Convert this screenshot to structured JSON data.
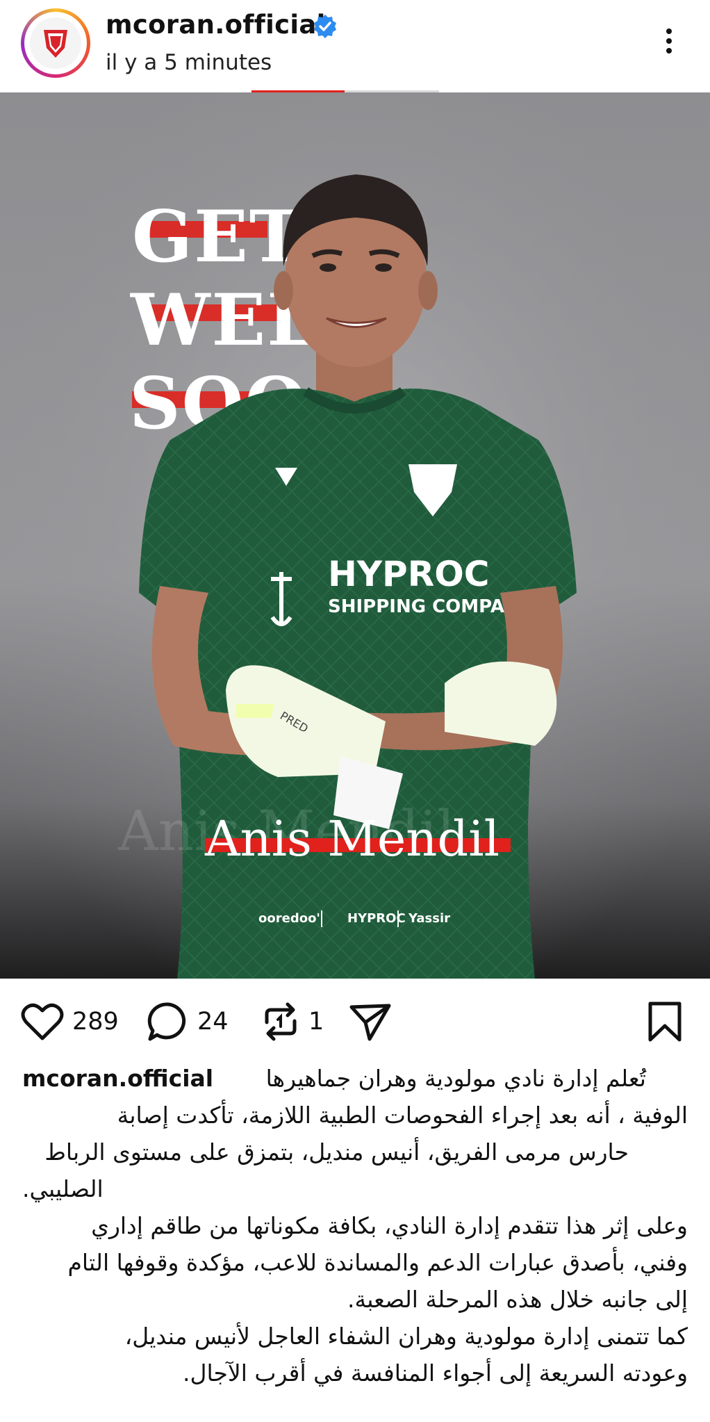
{
  "header": {
    "username": "mcoran.official",
    "timestamp": "il y a 5 minutes",
    "verified": true
  },
  "post": {
    "banner_lines": [
      "GET",
      "WEL",
      "SOO"
    ],
    "player_name": "Anis Mendil",
    "shirt_sponsor": "HYPROC",
    "shirt_sponsor_sub": "SHIPPING COMPA",
    "glove_text": "PRED",
    "sponsors": [
      "ooredoo'",
      "HYPROC",
      "Yassir"
    ],
    "colors": {
      "jersey": "#1f5a3b",
      "accent_red": "#e0211c",
      "background": "#8c8c8f"
    }
  },
  "actions": {
    "likes": "289",
    "comments": "24",
    "reposts": "1"
  },
  "caption": {
    "username": "mcoran.official",
    "line1": "تُعلم إدارة نادي مولودية وهران جماهيرها",
    "line2": "الوفية ، أنه بعد إجراء الفحوصات الطبية اللازمة، تأكدت إصابة",
    "line3": "حارس مرمى الفريق، أنيس منديل، بتمزق على مستوى الرباط",
    "line4": "الصليبي.",
    "line5": "وعلى إثر هذا تتقدم إدارة النادي، بكافة مكوناتها من طاقم إداري",
    "line6": "وفني، بأصدق عبارات الدعم والمساندة للاعب، مؤكدة وقوفها التام",
    "line7": "إلى جانبه خلال هذه المرحلة الصعبة.",
    "line8": "كما تتمنى إدارة مولودية وهران الشفاء العاجل لأنيس منديل،",
    "line9": "وعودته السريعة إلى أجواء المنافسة في أقرب الآجال."
  },
  "icons": [
    "verified-badge-icon",
    "more-options-icon",
    "heart-icon",
    "comment-icon",
    "repost-icon",
    "share-icon",
    "bookmark-icon"
  ]
}
